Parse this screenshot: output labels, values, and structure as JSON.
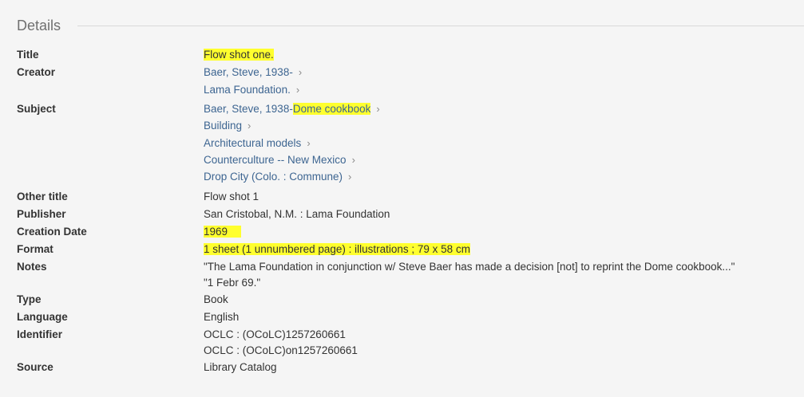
{
  "section": {
    "title": "Details"
  },
  "labels": {
    "title": "Title",
    "creator": "Creator",
    "subject": "Subject",
    "other_title": "Other title",
    "publisher": "Publisher",
    "creation_date": "Creation Date",
    "format": "Format",
    "notes": "Notes",
    "type": "Type",
    "language": "Language",
    "identifier": "Identifier",
    "source": "Source"
  },
  "values": {
    "title": "Flow shot one.",
    "creators": [
      "Baer, Steve, 1938-",
      "Lama Foundation."
    ],
    "subjects": {
      "first_prefix": "Baer, Steve, 1938-",
      "first_highlight": "Dome cookbook",
      "others": [
        "Building",
        "Architectural models",
        "Counterculture -- New Mexico",
        "Drop City (Colo. : Commune)"
      ]
    },
    "other_title": "Flow shot 1",
    "publisher": "San Cristobal, N.M. : Lama Foundation",
    "creation_date": "1969",
    "format": "1 sheet (1 unnumbered page) : illustrations ; 79 x 58 cm",
    "notes": [
      "\"The Lama Foundation in conjunction w/ Steve Baer has made a decision [not] to reprint the Dome cookbook...\"",
      "\"1 Febr 69.\""
    ],
    "type": "Book",
    "language": "English",
    "identifiers": [
      "OCLC : (OCoLC)1257260661",
      "OCLC : (OCoLC)on1257260661"
    ],
    "source": "Library Catalog"
  },
  "colors": {
    "highlight": "#ffff2e",
    "link": "#3d6591",
    "background": "#f5f5f5"
  },
  "icons": {
    "chevron": "chevron-right-icon"
  }
}
